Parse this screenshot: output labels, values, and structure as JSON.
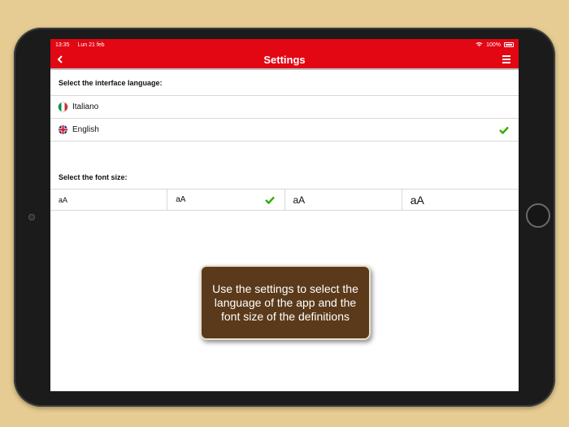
{
  "status_bar": {
    "time": "13:35",
    "date": "Lun 21 feb",
    "battery": "100%"
  },
  "nav": {
    "title": "Settings",
    "back_icon": "chevron-left-icon",
    "menu_icon": "hamburger-menu-icon"
  },
  "language_section": {
    "header": "Select the interface language:",
    "options": [
      {
        "label": "Italiano",
        "flag": "italy-flag-icon",
        "selected": false
      },
      {
        "label": "English",
        "flag": "uk-flag-icon",
        "selected": true
      }
    ]
  },
  "font_section": {
    "header": "Select the font size:",
    "options": [
      {
        "label": "aA",
        "selected": false
      },
      {
        "label": "aA",
        "selected": true
      },
      {
        "label": "aA",
        "selected": false
      },
      {
        "label": "aA",
        "selected": false
      }
    ]
  },
  "tooltip": {
    "text": "Use the settings to select the language of the app and the font size of the definitions"
  },
  "colors": {
    "accent": "#e30613",
    "check": "#2db000",
    "tooltip_bg": "#5a3a1a",
    "background": "#e6cc92"
  }
}
